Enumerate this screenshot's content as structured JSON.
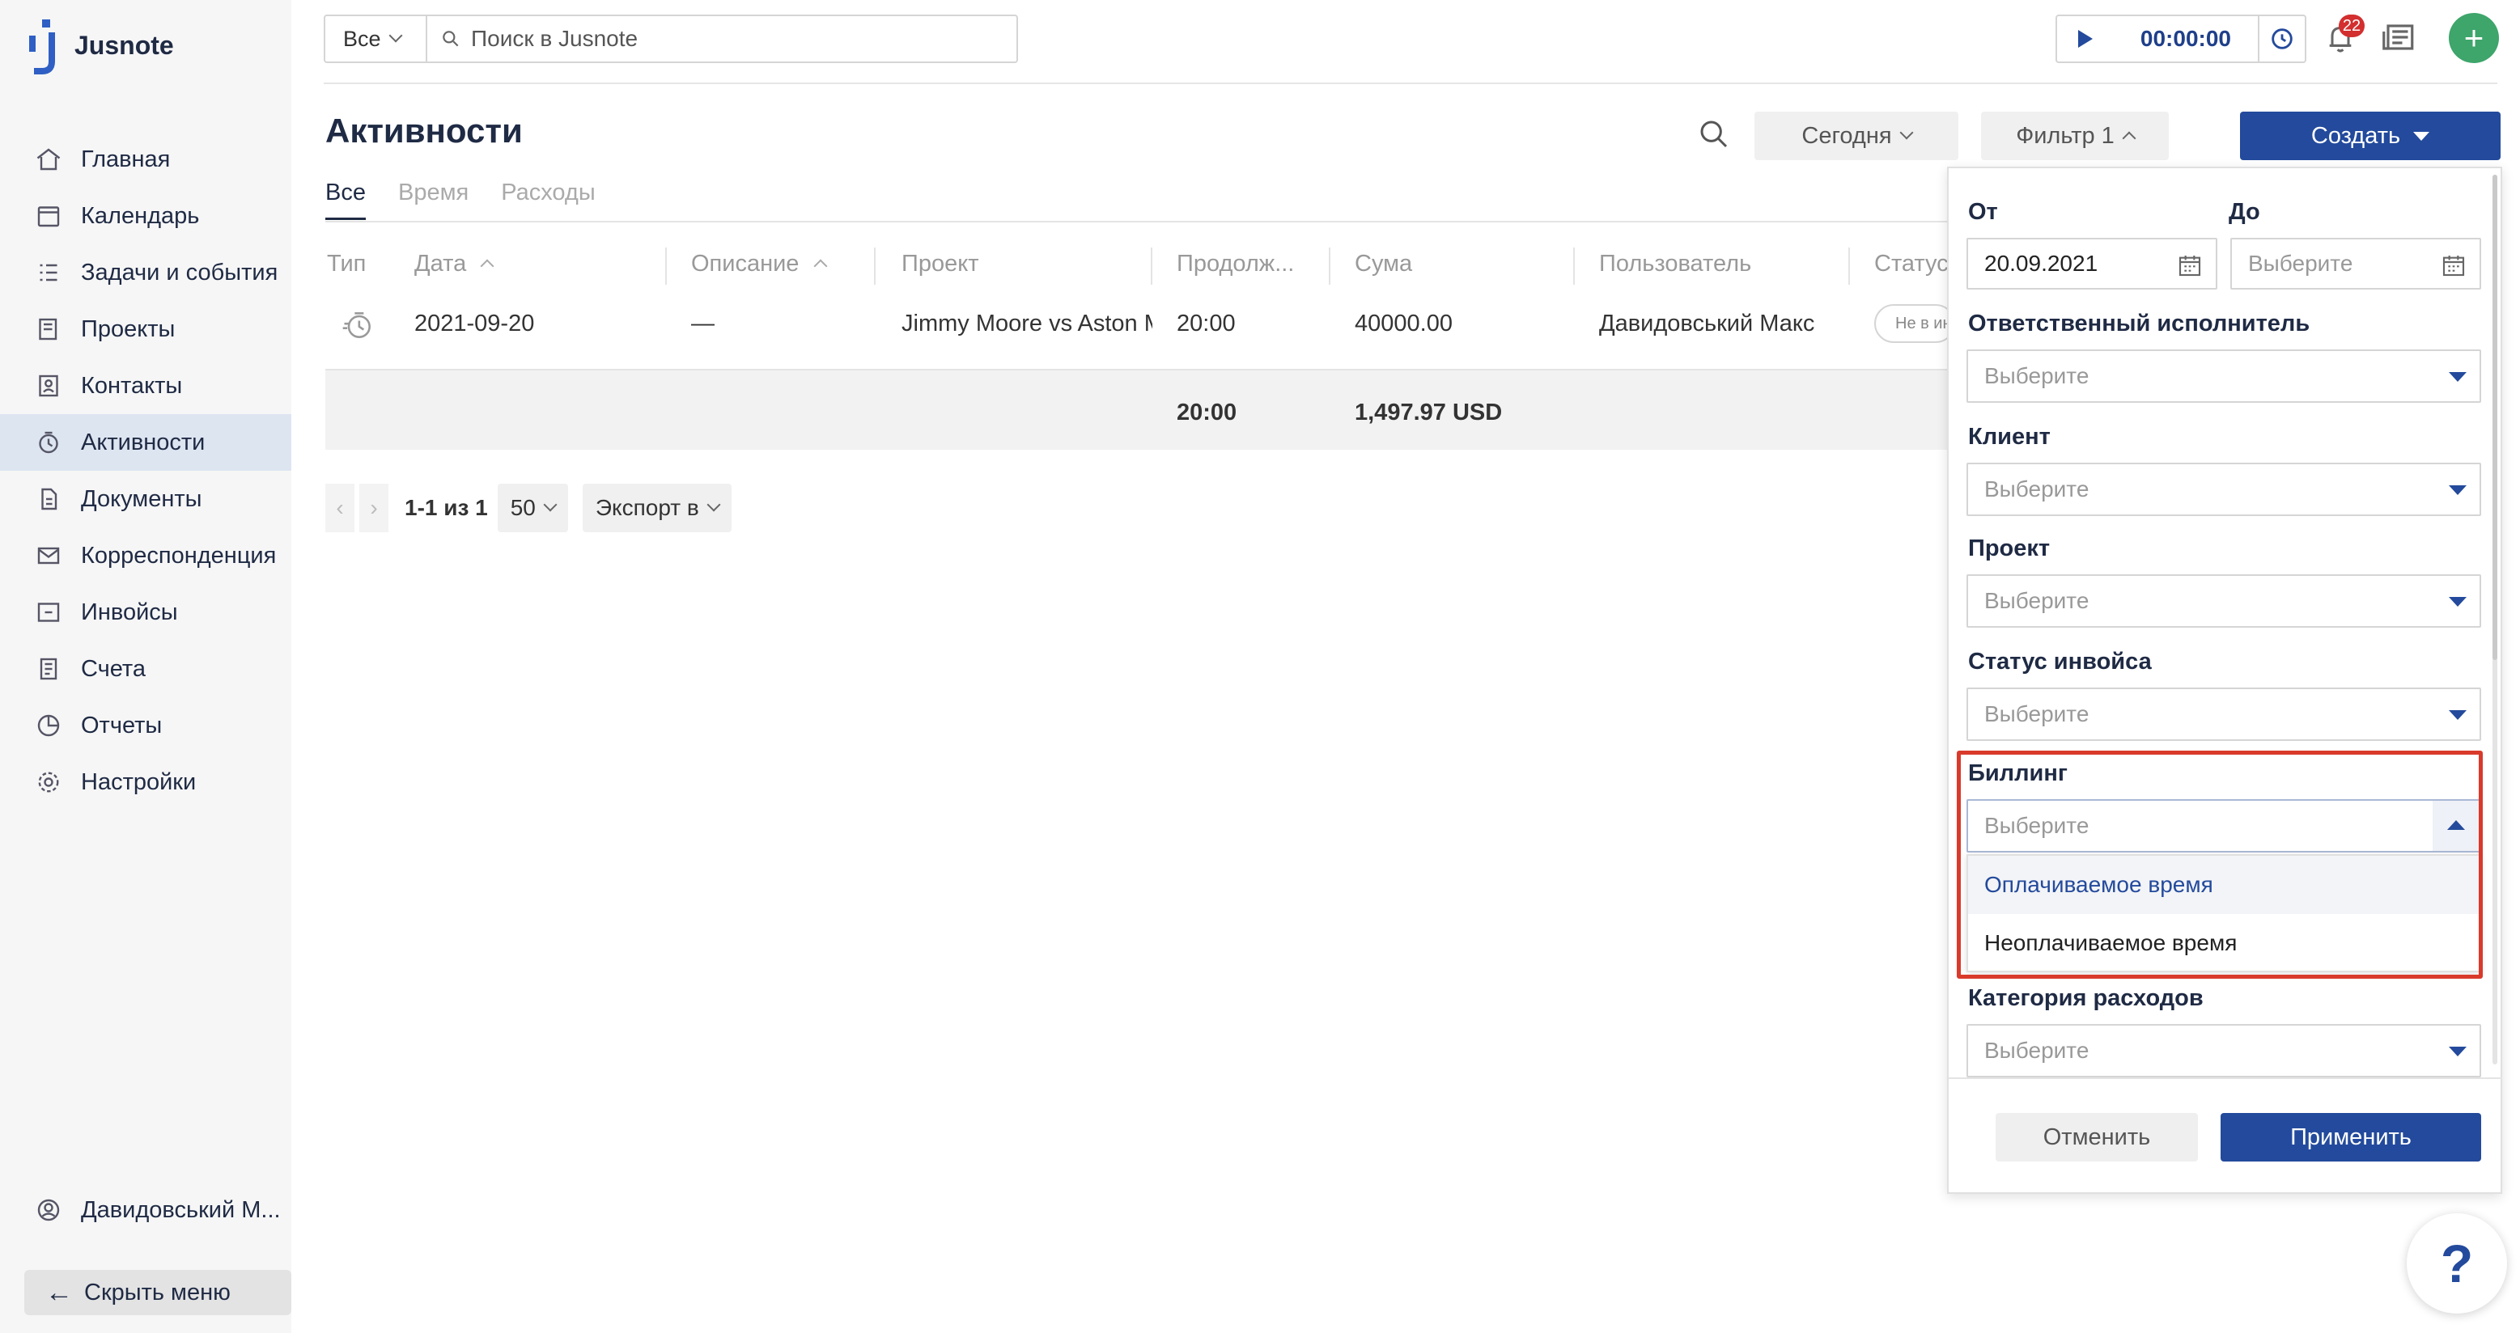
{
  "app": {
    "name": "Jusnote"
  },
  "sidebar": {
    "items": [
      {
        "label": "Главная",
        "icon": "home-icon"
      },
      {
        "label": "Календарь",
        "icon": "calendar-icon"
      },
      {
        "label": "Задачи и события",
        "icon": "tasks-icon"
      },
      {
        "label": "Проекты",
        "icon": "projects-icon"
      },
      {
        "label": "Контакты",
        "icon": "contacts-icon"
      },
      {
        "label": "Активности",
        "icon": "activity-icon",
        "active": true
      },
      {
        "label": "Документы",
        "icon": "documents-icon"
      },
      {
        "label": "Корреспонденция",
        "icon": "mail-icon"
      },
      {
        "label": "Инвойсы",
        "icon": "invoice-icon"
      },
      {
        "label": "Счета",
        "icon": "accounts-icon"
      },
      {
        "label": "Отчеты",
        "icon": "reports-icon"
      },
      {
        "label": "Настройки",
        "icon": "settings-icon"
      }
    ],
    "user": "Давидовський М...",
    "hide_menu": "Скрыть меню"
  },
  "topbar": {
    "scope": "Все",
    "search_placeholder": "Поиск в Jusnote",
    "timer": "00:00:00",
    "notifications": "22"
  },
  "page": {
    "title": "Активности",
    "today": "Сегодня",
    "filter": "Фильтр 1",
    "create": "Создать",
    "tabs": [
      "Все",
      "Время",
      "Расходы"
    ]
  },
  "table": {
    "headers": [
      "Тип",
      "Дата",
      "Описание",
      "Проект",
      "Продолж...",
      "Сума",
      "Пользователь",
      "Статус"
    ],
    "rows": [
      {
        "date": "2021-09-20",
        "description": "—",
        "project": "Jimmy Moore vs Aston M",
        "duration": "20:00",
        "amount": "40000.00",
        "user": "Давидовський Макс",
        "status": "Не в инвойсе"
      }
    ],
    "totals": {
      "duration": "20:00",
      "amount": "1,497.97 USD"
    }
  },
  "pager": {
    "range": "1-1 из 1",
    "per_page": "50",
    "export": "Экспорт в"
  },
  "filter_panel": {
    "from_label": "От",
    "from_value": "20.09.2021",
    "to_label": "До",
    "to_placeholder": "Выберите",
    "responsible_label": "Ответственный исполнитель",
    "client_label": "Клиент",
    "project_label": "Проект",
    "invoice_status_label": "Статус инвойса",
    "billing_label": "Биллинг",
    "expense_category_label": "Категория расходов",
    "placeholder": "Выберите",
    "billing_options": [
      "Оплачиваемое время",
      "Неоплачиваемое время"
    ],
    "cancel": "Отменить",
    "apply": "Применить"
  },
  "colors": {
    "accent": "#234a9c",
    "active_nav": "#dde5f1",
    "highlight": "#d93a2b",
    "add_button": "#3ea56b"
  }
}
